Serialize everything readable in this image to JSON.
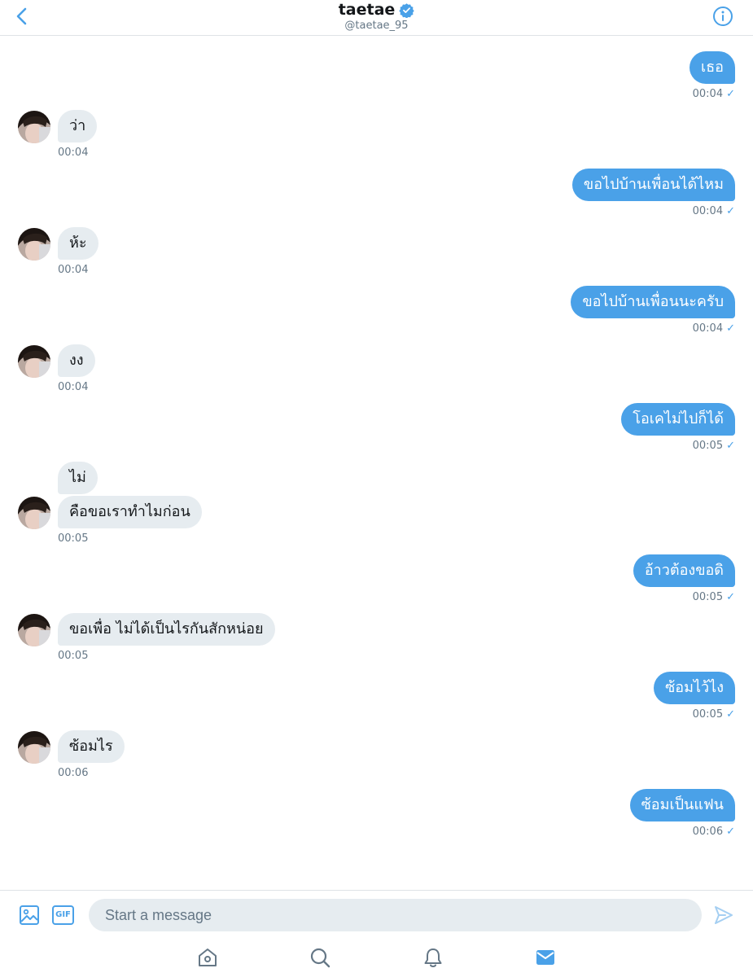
{
  "header": {
    "title": "taetae",
    "handle": "@taetae_95",
    "verified_icon": "verified-badge-icon",
    "back_icon": "chevron-left-icon",
    "info_icon": "info-icon"
  },
  "colors": {
    "accent": "#4aa1e8",
    "incoming_bubble": "#e6ecf0",
    "muted_text": "#657786"
  },
  "messages": [
    {
      "dir": "out",
      "text": "เธอ",
      "time": "00:04",
      "check": "✓"
    },
    {
      "dir": "in",
      "text": "ว่า",
      "time": "00:04"
    },
    {
      "dir": "out",
      "text": "ขอไปบ้านเพื่อนได้ไหม",
      "time": "00:04",
      "check": "✓"
    },
    {
      "dir": "in",
      "text": "ห้ะ",
      "time": "00:04"
    },
    {
      "dir": "out",
      "text": "ขอไปบ้านเพื่อนนะครับ",
      "time": "00:04",
      "check": "✓"
    },
    {
      "dir": "in",
      "text": "งง",
      "time": "00:04"
    },
    {
      "dir": "out",
      "text": "โอเคไม่ไปก็ได้",
      "time": "00:05",
      "check": "✓"
    },
    {
      "dir": "in",
      "text": "ไม่",
      "time": ""
    },
    {
      "dir": "in",
      "text": "คือขอเราทำไมก่อน",
      "time": "00:05"
    },
    {
      "dir": "out",
      "text": "อ้าวต้องขอดิ",
      "time": "00:05",
      "check": "✓"
    },
    {
      "dir": "in",
      "text": "ขอเพื่อ ไม่ได้เป็นไรกันสักหน่อย",
      "time": "00:05"
    },
    {
      "dir": "out",
      "text": "ซ้อมไว้ไง",
      "time": "00:05",
      "check": "✓"
    },
    {
      "dir": "in",
      "text": "ซ้อมไร",
      "time": "00:06"
    },
    {
      "dir": "out",
      "text": "ซ้อมเป็นแฟน",
      "time": "00:06",
      "check": "✓"
    }
  ],
  "composer": {
    "placeholder": "Start a message",
    "value": "",
    "gif_label": "GIF",
    "image_icon": "image-icon",
    "send_icon": "send-icon"
  },
  "tabbar": {
    "items": [
      "home-icon",
      "search-icon",
      "bell-icon",
      "mail-icon"
    ],
    "active": "mail-icon"
  }
}
